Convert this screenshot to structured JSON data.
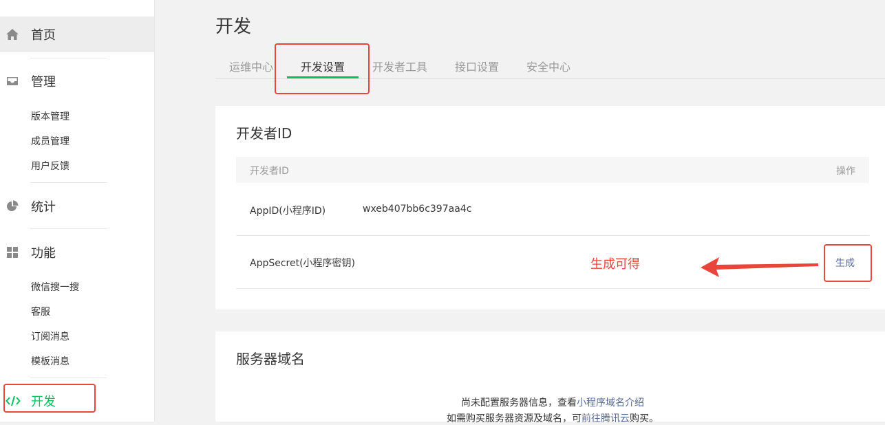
{
  "sidebar": {
    "home": {
      "label": "首页",
      "icon": "home-icon"
    },
    "manage": {
      "label": "管理",
      "icon": "inbox-icon",
      "items": [
        "版本管理",
        "成员管理",
        "用户反馈"
      ]
    },
    "stats": {
      "label": "统计",
      "icon": "pie-chart-icon"
    },
    "features": {
      "label": "功能",
      "icon": "grid-icon",
      "items": [
        "微信搜一搜",
        "客服",
        "订阅消息",
        "模板消息"
      ]
    },
    "dev": {
      "label": "开发",
      "icon": "code-icon"
    }
  },
  "page": {
    "title": "开发"
  },
  "tabs": [
    {
      "label": "运维中心"
    },
    {
      "label": "开发设置",
      "active": true
    },
    {
      "label": "开发者工具"
    },
    {
      "label": "接口设置"
    },
    {
      "label": "安全中心"
    }
  ],
  "developer_id": {
    "title": "开发者ID",
    "header_col1": "开发者ID",
    "header_col2": "操作",
    "appid_label": "AppID(小程序ID)",
    "appid_value": "wxeb407bb6c397aa4c",
    "secret_label": "AppSecret(小程序密钥)",
    "generate_label": "生成"
  },
  "server_domain": {
    "title": "服务器域名",
    "note_line1_prefix": "尚未配置服务器信息，查看",
    "note_line1_link": "小程序域名介绍",
    "note_line2_prefix": "如需购买服务器资源及域名，可",
    "note_line2_link": "前往腾讯云",
    "note_line2_suffix": "购买。"
  },
  "annotation": {
    "text": "生成可得",
    "color": "#e8463a"
  },
  "colors": {
    "accent": "#07c160",
    "link": "#576b95",
    "annotation": "#e8463a"
  }
}
